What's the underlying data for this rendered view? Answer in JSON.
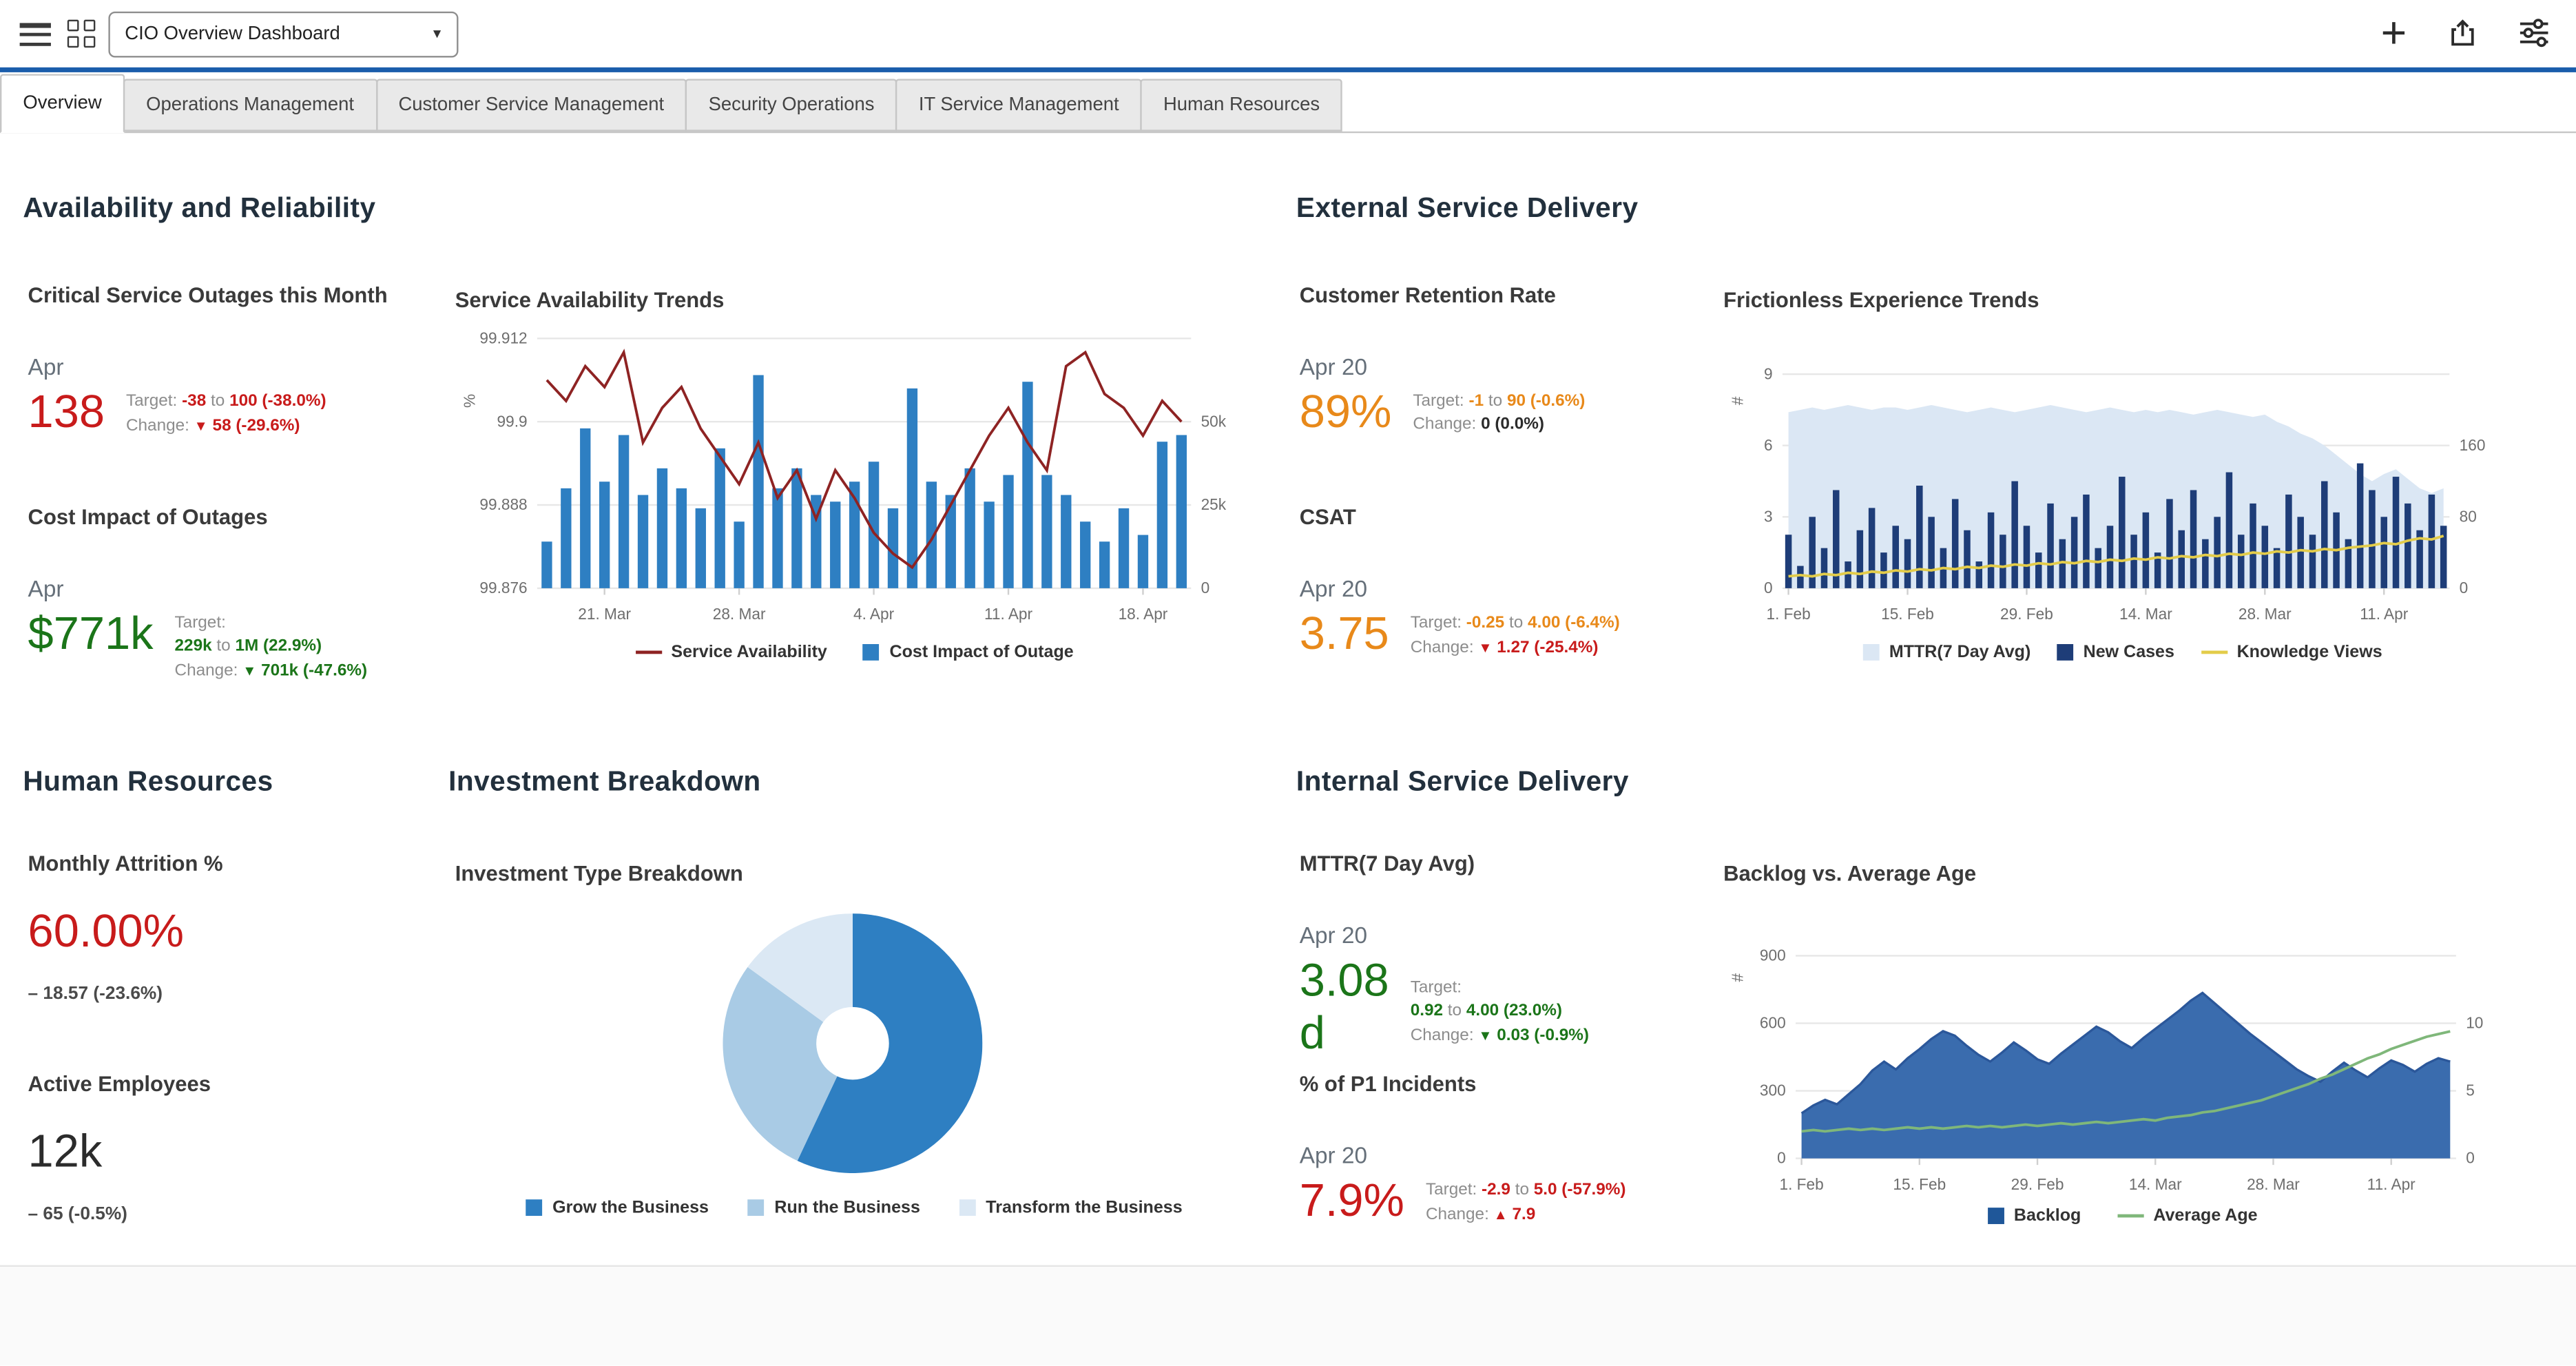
{
  "colors": {
    "accent": "#1a5dab",
    "metric_red": "#c81b1b",
    "metric_green": "#1b7519",
    "metric_orange": "#e8891a",
    "metric_dark": "#2b2b2b"
  },
  "header": {
    "dashboard_selector_value": "CIO Overview Dashboard"
  },
  "tabs": [
    {
      "label": "Overview"
    },
    {
      "label": "Operations Management"
    },
    {
      "label": "Customer Service Management"
    },
    {
      "label": "Security Operations"
    },
    {
      "label": "IT Service Management"
    },
    {
      "label": "Human Resources"
    }
  ],
  "labels": {
    "target": "Target:",
    "change": "Change:",
    "to": "to"
  },
  "sections": {
    "availability": {
      "heading": "Availability and Reliability",
      "outages": {
        "title": "Critical Service Outages this Month",
        "period": "Apr",
        "value": "138",
        "target_from": "-38",
        "target_to": "100 (-38.0%)",
        "change_arrow": "▼",
        "change_value": "58 (-29.6%)"
      },
      "cost": {
        "title": "Cost Impact of Outages",
        "period": "Apr",
        "value": "$771k",
        "target_from": "229k",
        "target_to": "1M (22.9%)",
        "change_arrow": "▼",
        "change_value": "701k (-47.6%)"
      }
    },
    "external": {
      "heading": "External Service Delivery",
      "retention": {
        "title": "Customer Retention Rate",
        "period": "Apr 20",
        "value": "89%",
        "target_from": "-1",
        "target_to": "90 (-0.6%)",
        "change_arrow": "",
        "change_value": "0 (0.0%)"
      },
      "csat": {
        "title": "CSAT",
        "period": "Apr 20",
        "value": "3.75",
        "target_from": "-0.25",
        "target_to": "4.00 (-6.4%)",
        "change_arrow": "▼",
        "change_value": "1.27 (-25.4%)"
      }
    },
    "hr": {
      "heading": "Human Resources",
      "attrition": {
        "title": "Monthly Attrition %",
        "value": "60.00%",
        "delta": "– 18.57 (-23.6%)"
      },
      "employees": {
        "title": "Active Employees",
        "value": "12k",
        "delta": "– 65 (-0.5%)"
      }
    },
    "investment": {
      "heading": "Investment Breakdown"
    },
    "internal": {
      "heading": "Internal Service Delivery",
      "mttr": {
        "title": "MTTR(7 Day Avg)",
        "period": "Apr 20",
        "value": "3.08",
        "unit": "d",
        "target_from": "0.92",
        "target_to": "4.00 (23.0%)",
        "change_arrow": "▼",
        "change_value": "0.03 (-0.9%)"
      },
      "p1": {
        "title": "% of P1 Incidents",
        "period": "Apr 20",
        "value": "7.9%",
        "target_from": "-2.9",
        "target_to": "5.0 (-57.9%)",
        "change_arrow": "▲",
        "change_value": "7.9"
      }
    }
  },
  "chart_data": [
    {
      "id": "service-availability-trends",
      "type": "combo",
      "title": "Service Availability Trends",
      "left_axis": {
        "label": "%",
        "min": 99.876,
        "max": 99.912,
        "ticks": [
          99.876,
          99.888,
          99.9,
          99.912
        ],
        "tick_labels": [
          "99.876",
          "99.888",
          "99.9",
          "99.912"
        ]
      },
      "right_axis": {
        "min": 0,
        "max": 75,
        "ticks": [
          0,
          25,
          50
        ],
        "tick_labels": [
          "0",
          "25k",
          "50k"
        ]
      },
      "x_tick_labels": [
        "21. Mar",
        "28. Mar",
        "4. Apr",
        "11. Apr",
        "18. Apr"
      ],
      "x_tick_indices": [
        3,
        10,
        17,
        24,
        31
      ],
      "series": [
        {
          "name": "Cost Impact of Outage",
          "kind": "bar",
          "axis": "right",
          "color": "#2e7fc2",
          "values": [
            14,
            30,
            48,
            32,
            46,
            28,
            36,
            30,
            24,
            42,
            20,
            64,
            30,
            36,
            28,
            26,
            32,
            38,
            24,
            60,
            32,
            28,
            36,
            26,
            34,
            62,
            34,
            28,
            20,
            14,
            24,
            16,
            44,
            46
          ]
        },
        {
          "name": "Service Availability",
          "kind": "line",
          "axis": "left",
          "color": "#8e2323",
          "values": [
            99.906,
            99.903,
            99.908,
            99.905,
            99.91,
            99.897,
            99.902,
            99.905,
            99.899,
            99.895,
            99.891,
            99.897,
            99.889,
            99.893,
            99.886,
            99.893,
            99.889,
            99.884,
            99.881,
            99.879,
            99.883,
            99.888,
            99.893,
            99.898,
            99.902,
            99.897,
            99.893,
            99.908,
            99.91,
            99.904,
            99.902,
            99.898,
            99.903,
            99.9
          ]
        }
      ],
      "legend": [
        {
          "label": "Service Availability",
          "swatch": "line",
          "color": "#8e2323"
        },
        {
          "label": "Cost Impact of Outage",
          "swatch": "square",
          "color": "#2e7fc2"
        }
      ]
    },
    {
      "id": "frictionless-experience-trends",
      "type": "combo",
      "title": "Frictionless Experience Trends",
      "left_axis": {
        "label": "#",
        "min": 0,
        "max": 10.5,
        "ticks": [
          0,
          3,
          6,
          9
        ],
        "tick_labels": [
          "0",
          "3",
          "6",
          "9"
        ]
      },
      "right_axis": {
        "min": 0,
        "max": 280,
        "ticks": [
          0,
          80,
          160
        ],
        "tick_labels": [
          "0",
          "80",
          "160"
        ]
      },
      "x_tick_labels": [
        "1. Feb",
        "15. Feb",
        "29. Feb",
        "14. Mar",
        "28. Mar",
        "11. Apr"
      ],
      "x_tick_indices": [
        0,
        10,
        20,
        30,
        40,
        50
      ],
      "series": [
        {
          "name": "MTTR(7 Day Avg)",
          "kind": "area",
          "axis": "left",
          "color": "#dbe7f4",
          "values": [
            7.4,
            7.5,
            7.6,
            7.5,
            7.6,
            7.7,
            7.6,
            7.5,
            7.6,
            7.6,
            7.5,
            7.6,
            7.7,
            7.6,
            7.5,
            7.4,
            7.5,
            7.6,
            7.5,
            7.4,
            7.5,
            7.6,
            7.7,
            7.6,
            7.5,
            7.4,
            7.5,
            7.6,
            7.5,
            7.4,
            7.5,
            7.4,
            7.5,
            7.4,
            7.3,
            7.4,
            7.5,
            7.4,
            7.3,
            7.2,
            7.3,
            7.0,
            6.8,
            6.5,
            6.3,
            6.0,
            5.6,
            5.2,
            4.8,
            4.5,
            4.8,
            5.0,
            4.6,
            4.2,
            4.0,
            4.2
          ]
        },
        {
          "name": "New Cases",
          "kind": "bar",
          "axis": "right",
          "color": "#1e3d78",
          "values": [
            60,
            25,
            80,
            45,
            110,
            30,
            65,
            90,
            40,
            70,
            55,
            115,
            80,
            45,
            100,
            65,
            30,
            85,
            60,
            120,
            70,
            40,
            95,
            55,
            80,
            105,
            45,
            70,
            125,
            60,
            85,
            40,
            100,
            65,
            110,
            55,
            80,
            130,
            60,
            95,
            70,
            45,
            105,
            80,
            60,
            120,
            85,
            55,
            140,
            110,
            80,
            125,
            95,
            65,
            105,
            70
          ]
        },
        {
          "name": "Knowledge Views",
          "kind": "line",
          "axis": "left",
          "color": "#e3cc4a",
          "values": [
            0.5,
            0.55,
            0.5,
            0.6,
            0.55,
            0.65,
            0.6,
            0.7,
            0.65,
            0.75,
            0.7,
            0.8,
            0.75,
            0.85,
            0.8,
            0.9,
            0.85,
            0.95,
            0.9,
            1.0,
            0.95,
            1.05,
            1.0,
            1.1,
            1.05,
            1.15,
            1.1,
            1.2,
            1.15,
            1.25,
            1.2,
            1.3,
            1.25,
            1.35,
            1.3,
            1.4,
            1.35,
            1.45,
            1.4,
            1.5,
            1.45,
            1.55,
            1.5,
            1.6,
            1.55,
            1.65,
            1.6,
            1.7,
            1.75,
            1.8,
            1.9,
            1.85,
            2.0,
            2.1,
            2.05,
            2.2
          ]
        }
      ],
      "legend": [
        {
          "label": "MTTR(7 Day Avg)",
          "swatch": "square",
          "color": "#dbe7f4"
        },
        {
          "label": "New Cases",
          "swatch": "square",
          "color": "#1e3d78"
        },
        {
          "label": "Knowledge Views",
          "swatch": "line",
          "color": "#e3cc4a"
        }
      ]
    },
    {
      "id": "investment-type-breakdown",
      "type": "donut",
      "title": "Investment Type Breakdown",
      "slices": [
        {
          "label": "Grow the Business",
          "value": 57,
          "color": "#2e7fc2"
        },
        {
          "label": "Run the Business",
          "value": 28,
          "color": "#a9cbe5"
        },
        {
          "label": "Transform the Business",
          "value": 15,
          "color": "#dbe8f4"
        }
      ]
    },
    {
      "id": "backlog-vs-average-age",
      "type": "combo",
      "title": "Backlog vs. Average Age",
      "left_axis": {
        "label": "#",
        "min": 0,
        "max": 1080,
        "ticks": [
          0,
          300,
          600,
          900
        ],
        "tick_labels": [
          "0",
          "300",
          "600",
          "900"
        ]
      },
      "right_axis": {
        "min": 0,
        "max": 18,
        "ticks": [
          0,
          5,
          10
        ],
        "tick_labels": [
          "0",
          "5",
          "10"
        ]
      },
      "x_tick_labels": [
        "1. Feb",
        "15. Feb",
        "29. Feb",
        "14. Mar",
        "28. Mar",
        "11. Apr"
      ],
      "x_tick_indices": [
        0,
        10,
        20,
        30,
        40,
        50
      ],
      "series": [
        {
          "name": "Backlog",
          "kind": "area",
          "axis": "left",
          "color": "#3a6cae",
          "stroke": "#2b579a",
          "values": [
            200,
            235,
            260,
            240,
            285,
            330,
            390,
            430,
            395,
            445,
            485,
            530,
            565,
            545,
            500,
            460,
            430,
            470,
            515,
            480,
            440,
            420,
            465,
            505,
            545,
            585,
            560,
            520,
            490,
            535,
            575,
            615,
            655,
            700,
            735,
            690,
            645,
            600,
            555,
            515,
            475,
            435,
            395,
            365,
            340,
            385,
            425,
            390,
            360,
            400,
            435,
            415,
            385,
            420,
            445,
            430
          ]
        },
        {
          "name": "Average Age",
          "kind": "line",
          "axis": "right",
          "color": "#7fb77a",
          "values": [
            2.0,
            2.1,
            2.0,
            2.1,
            2.2,
            2.1,
            2.2,
            2.1,
            2.2,
            2.3,
            2.2,
            2.3,
            2.2,
            2.3,
            2.4,
            2.3,
            2.4,
            2.3,
            2.4,
            2.5,
            2.4,
            2.5,
            2.6,
            2.5,
            2.6,
            2.7,
            2.6,
            2.7,
            2.8,
            2.9,
            2.8,
            3.0,
            3.1,
            3.2,
            3.4,
            3.5,
            3.7,
            3.9,
            4.1,
            4.3,
            4.6,
            4.9,
            5.2,
            5.5,
            5.9,
            6.2,
            6.6,
            7.0,
            7.4,
            7.7,
            8.1,
            8.4,
            8.7,
            9.0,
            9.2,
            9.4
          ]
        }
      ],
      "legend": [
        {
          "label": "Backlog",
          "swatch": "square",
          "color": "#1f5799"
        },
        {
          "label": "Average Age",
          "swatch": "line",
          "color": "#7fb77a"
        }
      ]
    }
  ]
}
